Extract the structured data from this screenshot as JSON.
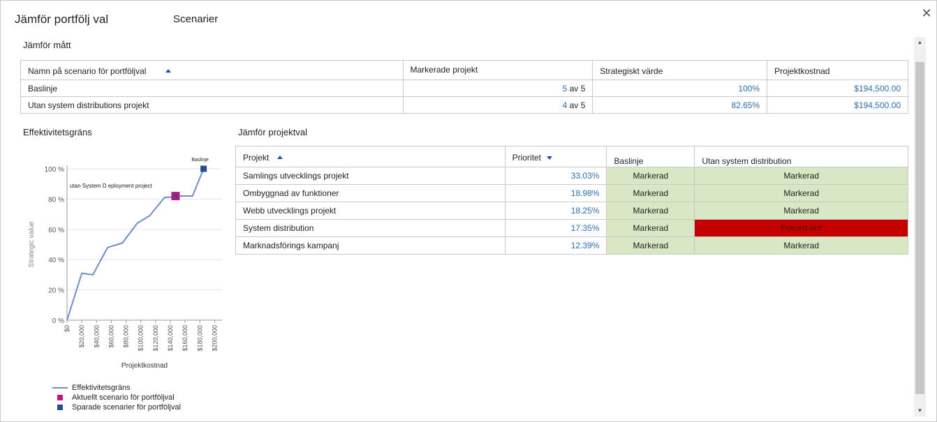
{
  "dialog": {
    "title": "Jämför portfölj val",
    "subtitle": "Scenarier",
    "close_symbol": "✕"
  },
  "metrics": {
    "section_title": "Jämför mått",
    "headers": [
      "Namn på scenario för portföljval",
      "Markerade projekt",
      "Strategiskt värde",
      "Projektkostnad"
    ],
    "rows": [
      {
        "name": "Baslinje",
        "selected": "5",
        "of_label": "av 5",
        "value": "100%",
        "cost": "$194,500.00"
      },
      {
        "name": "Utan system distributions projekt",
        "selected": "4",
        "of_label": "av 5",
        "value": "82.65%",
        "cost": "$194,500.00"
      }
    ]
  },
  "projects": {
    "section_title": "Jämför projektval",
    "headers": [
      "Projekt",
      "Prioritet",
      "Baslinje",
      "Utan system distribution"
    ],
    "rows": [
      {
        "name": "Samlings utvecklings projekt",
        "priority": "33.03%",
        "baseline": "Markerad",
        "scenario": "Markerad",
        "scenario_status": "marked"
      },
      {
        "name": "Ombyggnad av funktioner",
        "priority": "18.98%",
        "baseline": "Markerad",
        "scenario": "Markerad",
        "scenario_status": "marked"
      },
      {
        "name": "Webb utvecklings projekt",
        "priority": "18.25%",
        "baseline": "Markerad",
        "scenario": "Markerad",
        "scenario_status": "marked"
      },
      {
        "name": "System distribution",
        "priority": "17.35%",
        "baseline": "Markerad",
        "scenario": "Forced-out",
        "scenario_status": "forced"
      },
      {
        "name": "Marknadsförings kampanj",
        "priority": "12.39%",
        "baseline": "Markerad",
        "scenario": "Markerad",
        "scenario_status": "marked"
      }
    ]
  },
  "chart": {
    "section_title": "Effektivitetsgräns",
    "colors": {
      "line": "#6f8dc5",
      "current": "#c0177d",
      "saved": "#2b4a96",
      "grid": "#e6e6e6"
    },
    "legend": [
      {
        "label": "Effektivitetsgräns",
        "kind": "line"
      },
      {
        "label": "Aktuellt scenario för portföljval",
        "kind": "current"
      },
      {
        "label": "Sparade scenarier för portföljval",
        "kind": "saved"
      }
    ]
  },
  "chart_data": {
    "type": "line",
    "xlabel": "Projektkostnad",
    "ylabel": "Strategic value",
    "xlim": [
      0,
      210000
    ],
    "ylim": [
      0,
      100
    ],
    "x_ticks": [
      0,
      20000,
      40000,
      60000,
      80000,
      100000,
      120000,
      140000,
      160000,
      180000,
      200000
    ],
    "x_tick_labels": [
      "$0",
      "$20,000",
      "$40,000",
      "$60,000",
      "$80,000",
      "$100,000",
      "$120,000",
      "$140,000",
      "$160,000",
      "$180,000",
      "$200,000"
    ],
    "y_ticks": [
      0,
      20,
      40,
      60,
      80,
      100
    ],
    "y_tick_labels": [
      "0 %",
      "20 %",
      "40 %",
      "60 %",
      "80 %",
      "100 %"
    ],
    "series": [
      {
        "name": "Effektivitetsgräns",
        "x": [
          0,
          20000,
          35000,
          55000,
          75000,
          95000,
          112000,
          132000,
          155000,
          170000,
          185000
        ],
        "y": [
          0,
          31,
          30,
          48,
          51,
          64,
          69,
          81,
          82,
          82,
          100
        ]
      }
    ],
    "points": [
      {
        "series": "Sparade scenarier för portföljval",
        "label": "Baslinje",
        "x": 185000,
        "y": 100
      },
      {
        "series": "Aktuellt scenario för portföljval",
        "label": "utan System D eployment project",
        "x": 147000,
        "y": 82
      }
    ]
  }
}
